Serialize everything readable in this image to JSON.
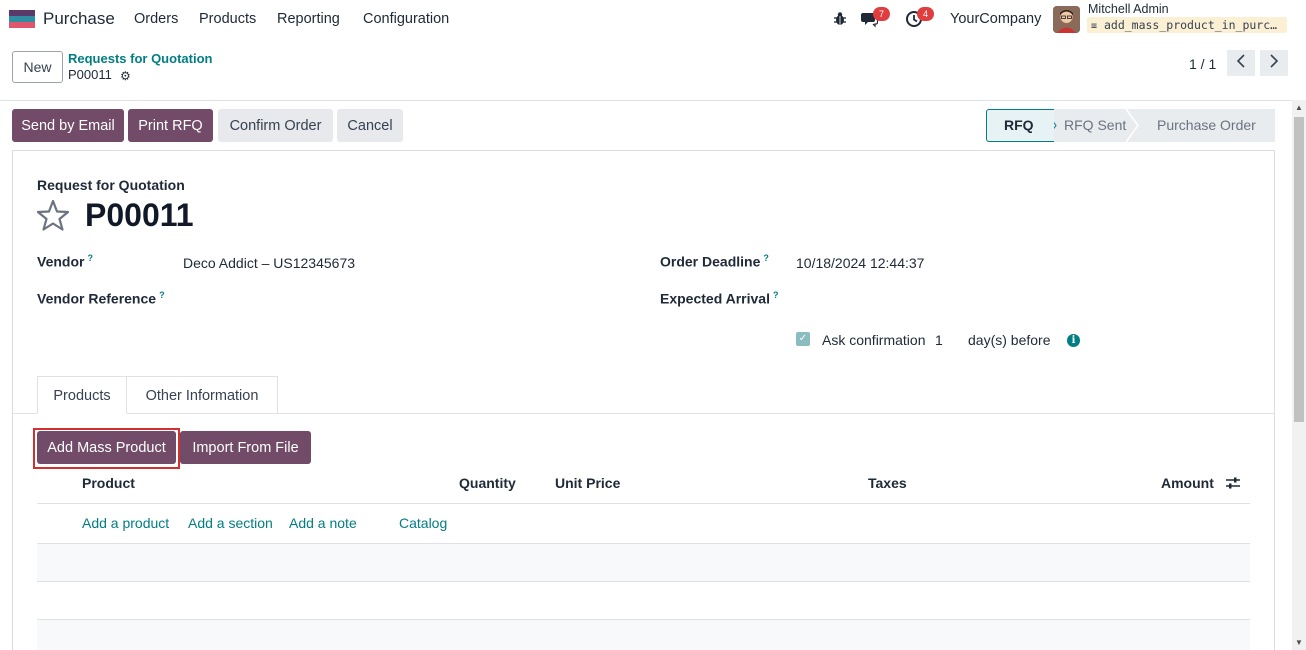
{
  "navbar": {
    "app_name": "Purchase",
    "menu": [
      "Orders",
      "Products",
      "Reporting",
      "Configuration"
    ],
    "messages_count": "7",
    "activities_count": "4",
    "company": "YourCompany",
    "user_name": "Mitchell Admin",
    "database": "add_mass_product_in_purc…"
  },
  "control": {
    "new_label": "New",
    "breadcrumb_parent": "Requests for Quotation",
    "breadcrumb_current": "P00011",
    "pager": "1 / 1"
  },
  "actions": {
    "send_email": "Send by Email",
    "print_rfq": "Print RFQ",
    "confirm_order": "Confirm Order",
    "cancel": "Cancel"
  },
  "statusbar": {
    "stages": [
      "RFQ",
      "RFQ Sent",
      "Purchase Order"
    ],
    "active": "RFQ"
  },
  "form": {
    "caption": "Request for Quotation",
    "name": "P00011",
    "vendor_label": "Vendor",
    "vendor_value": "Deco Addict – US12345673",
    "vendor_ref_label": "Vendor Reference",
    "order_deadline_label": "Order Deadline",
    "order_deadline_value": "10/18/2024 12:44:37",
    "expected_arrival_label": "Expected Arrival",
    "ask_confirmation_label": "Ask confirmation",
    "ask_confirmation_days": "1",
    "ask_confirmation_suffix": "day(s) before",
    "help_mark": "?"
  },
  "tabs": [
    "Products",
    "Other Information"
  ],
  "lines": {
    "add_mass_product": "Add Mass Product",
    "import_from_file": "Import From File",
    "columns": [
      "Product",
      "Quantity",
      "Unit Price",
      "Taxes",
      "Amount"
    ],
    "add_links": [
      "Add a product",
      "Add a section",
      "Add a note",
      "Catalog"
    ]
  },
  "colors": {
    "brand": "#714b67",
    "accent": "#017e84",
    "highlight": "#d32f2f"
  }
}
